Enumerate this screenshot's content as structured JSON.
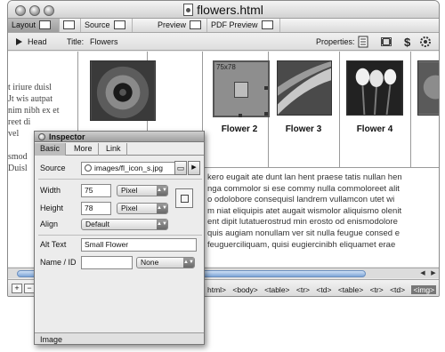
{
  "window": {
    "title": "flowers.html"
  },
  "viewbar": {
    "tabs": [
      {
        "label": "Layout"
      },
      {
        "label": "Source"
      },
      {
        "label": "Preview"
      },
      {
        "label": "PDF Preview"
      }
    ]
  },
  "headbar": {
    "head_label": "Head",
    "title_label": "Title:",
    "title_value": "Flowers",
    "properties_label": "Properties:"
  },
  "page": {
    "left_text": [
      "t iriure duisl",
      "Jt wis autpat",
      "nim nibh ex et",
      "reet di",
      "vel",
      "",
      "smod",
      "Duisl"
    ],
    "placeholder_size": "75x78",
    "captions": [
      "Flower 2",
      "Flower 3",
      "Flower 4"
    ],
    "body_text": [
      "kero eugait ate dunt lan hent praese tatis nullan hen",
      "nga commolor si ese commy nulla commoloreet alit",
      "o odolobore consequisl landrem vullamcon utet wi",
      "m niat eliquipis atet augait wismolor aliquismo olenit",
      "ent dipit lutatuerostrud min erosto od enismodolore",
      "quis augiam nonullam ver sit nulla feugue consed e",
      "feuguerciliquam, quisi eugiercinibh eliquamet erae"
    ]
  },
  "statusbar": {
    "tags": [
      "html>",
      "<body>",
      "<table>",
      "<tr>",
      "<td>",
      "<table>",
      "<tr>",
      "<td>"
    ],
    "selected_tag": "<img>"
  },
  "inspector": {
    "title": "Inspector",
    "tabs": [
      "Basic",
      "More",
      "Link"
    ],
    "source_label": "Source",
    "source_value": "images/fl_icon_s.jpg",
    "width_label": "Width",
    "width_value": "75",
    "width_unit": "Pixel",
    "height_label": "Height",
    "height_value": "78",
    "height_unit": "Pixel",
    "align_label": "Align",
    "align_value": "Default",
    "alt_label": "Alt Text",
    "alt_value": "Small Flower",
    "name_label": "Name / ID",
    "name_value": "",
    "name_option": "None",
    "status": "Image"
  },
  "colors": {
    "accent_scroll": "#7ea6d8",
    "window_bg": "#e9e9e9"
  },
  "icons": [
    "layout-view-icon",
    "source-view-icon",
    "preview-icon",
    "pdf-preview-icon",
    "document-properties-icon",
    "film-icon",
    "dollar-sign-icon",
    "gear-icon"
  ]
}
